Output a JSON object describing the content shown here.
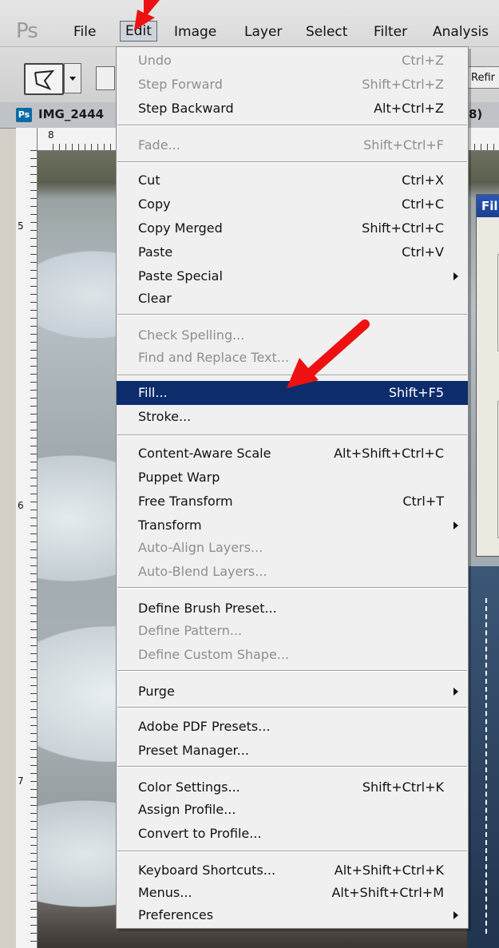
{
  "app": {
    "logo": "Ps",
    "menubar": [
      "File",
      "Edit",
      "Image",
      "Layer",
      "Select",
      "Filter",
      "Analysis"
    ],
    "active_menu": "Edit"
  },
  "options_bar": {
    "refine_label": "Refir"
  },
  "document": {
    "badge": "Ps",
    "tab_name": "IMG_2444",
    "tab_suffix": "8)"
  },
  "rulers": {
    "top_label": "8",
    "left_labels": [
      "5",
      "6",
      "7"
    ]
  },
  "fill_dialog": {
    "title": "Fil"
  },
  "edit_menu": {
    "items": [
      {
        "label": "Undo",
        "shortcut": "Ctrl+Z",
        "disabled": true
      },
      {
        "label": "Step Forward",
        "shortcut": "Shift+Ctrl+Z",
        "disabled": true
      },
      {
        "label": "Step Backward",
        "shortcut": "Alt+Ctrl+Z",
        "disabled": false
      },
      {
        "label": "Fade...",
        "shortcut": "Shift+Ctrl+F",
        "disabled": true
      },
      {
        "label": "Cut",
        "shortcut": "Ctrl+X",
        "disabled": false
      },
      {
        "label": "Copy",
        "shortcut": "Ctrl+C",
        "disabled": false
      },
      {
        "label": "Copy Merged",
        "shortcut": "Shift+Ctrl+C",
        "disabled": false
      },
      {
        "label": "Paste",
        "shortcut": "Ctrl+V",
        "disabled": false
      },
      {
        "label": "Paste Special",
        "shortcut": "",
        "disabled": false,
        "submenu": true
      },
      {
        "label": "Clear",
        "shortcut": "",
        "disabled": false
      },
      {
        "label": "Check Spelling...",
        "shortcut": "",
        "disabled": true
      },
      {
        "label": "Find and Replace Text...",
        "shortcut": "",
        "disabled": true
      },
      {
        "label": "Fill...",
        "shortcut": "Shift+F5",
        "disabled": false,
        "highlighted": true
      },
      {
        "label": "Stroke...",
        "shortcut": "",
        "disabled": false
      },
      {
        "label": "Content-Aware Scale",
        "shortcut": "Alt+Shift+Ctrl+C",
        "disabled": false
      },
      {
        "label": "Puppet Warp",
        "shortcut": "",
        "disabled": false
      },
      {
        "label": "Free Transform",
        "shortcut": "Ctrl+T",
        "disabled": false
      },
      {
        "label": "Transform",
        "shortcut": "",
        "disabled": false,
        "submenu": true
      },
      {
        "label": "Auto-Align Layers...",
        "shortcut": "",
        "disabled": true
      },
      {
        "label": "Auto-Blend Layers...",
        "shortcut": "",
        "disabled": true
      },
      {
        "label": "Define Brush Preset...",
        "shortcut": "",
        "disabled": false
      },
      {
        "label": "Define Pattern...",
        "shortcut": "",
        "disabled": true
      },
      {
        "label": "Define Custom Shape...",
        "shortcut": "",
        "disabled": true
      },
      {
        "label": "Purge",
        "shortcut": "",
        "disabled": false,
        "submenu": true
      },
      {
        "label": "Adobe PDF Presets...",
        "shortcut": "",
        "disabled": false
      },
      {
        "label": "Preset Manager...",
        "shortcut": "",
        "disabled": false
      },
      {
        "label": "Color Settings...",
        "shortcut": "Shift+Ctrl+K",
        "disabled": false
      },
      {
        "label": "Assign Profile...",
        "shortcut": "",
        "disabled": false
      },
      {
        "label": "Convert to Profile...",
        "shortcut": "",
        "disabled": false
      },
      {
        "label": "Keyboard Shortcuts...",
        "shortcut": "Alt+Shift+Ctrl+K",
        "disabled": false
      },
      {
        "label": "Menus...",
        "shortcut": "Alt+Shift+Ctrl+M",
        "disabled": false
      },
      {
        "label": "Preferences",
        "shortcut": "",
        "disabled": false,
        "submenu": true
      }
    ]
  },
  "colors": {
    "highlight": "#0d2c6c",
    "annotation_arrow": "#ee1111"
  }
}
